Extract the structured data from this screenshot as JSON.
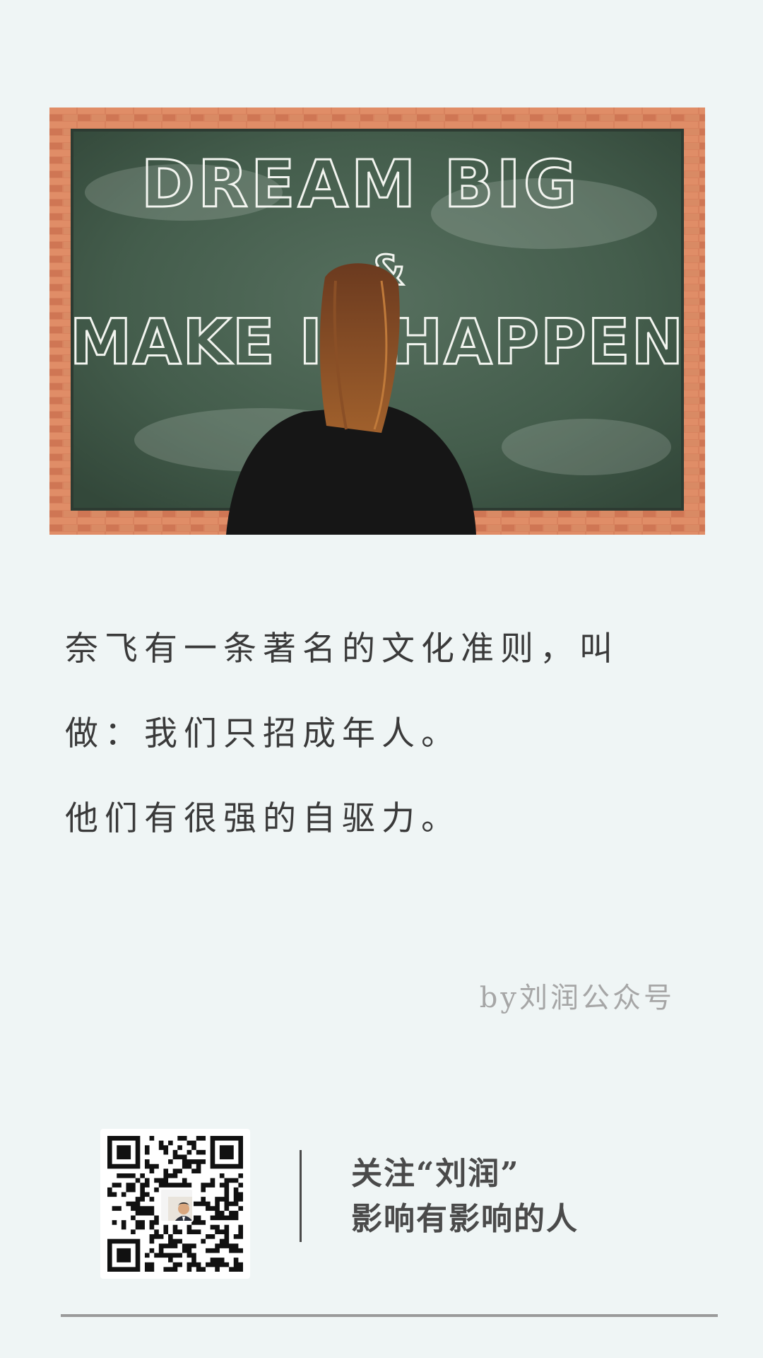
{
  "hero": {
    "board_line1": "DREAM BIG",
    "board_amp": "&",
    "board_line2": "MAKE IT HAPPEN"
  },
  "article": {
    "line1": "奈飞有一条著名的文化准则，叫",
    "line2": "做：我们只招成年人。",
    "line3": "他们有很强的自驱力。",
    "byline": "by刘润公众号"
  },
  "footer": {
    "follow_line1": "关注“刘润”",
    "follow_line2": "影响有影响的人"
  },
  "colors": {
    "background": "#eff5f5",
    "text": "#3a3a3a",
    "byline": "#a6a6a6",
    "chalkboard": "#3f5a48",
    "brick": "#d9805c"
  }
}
